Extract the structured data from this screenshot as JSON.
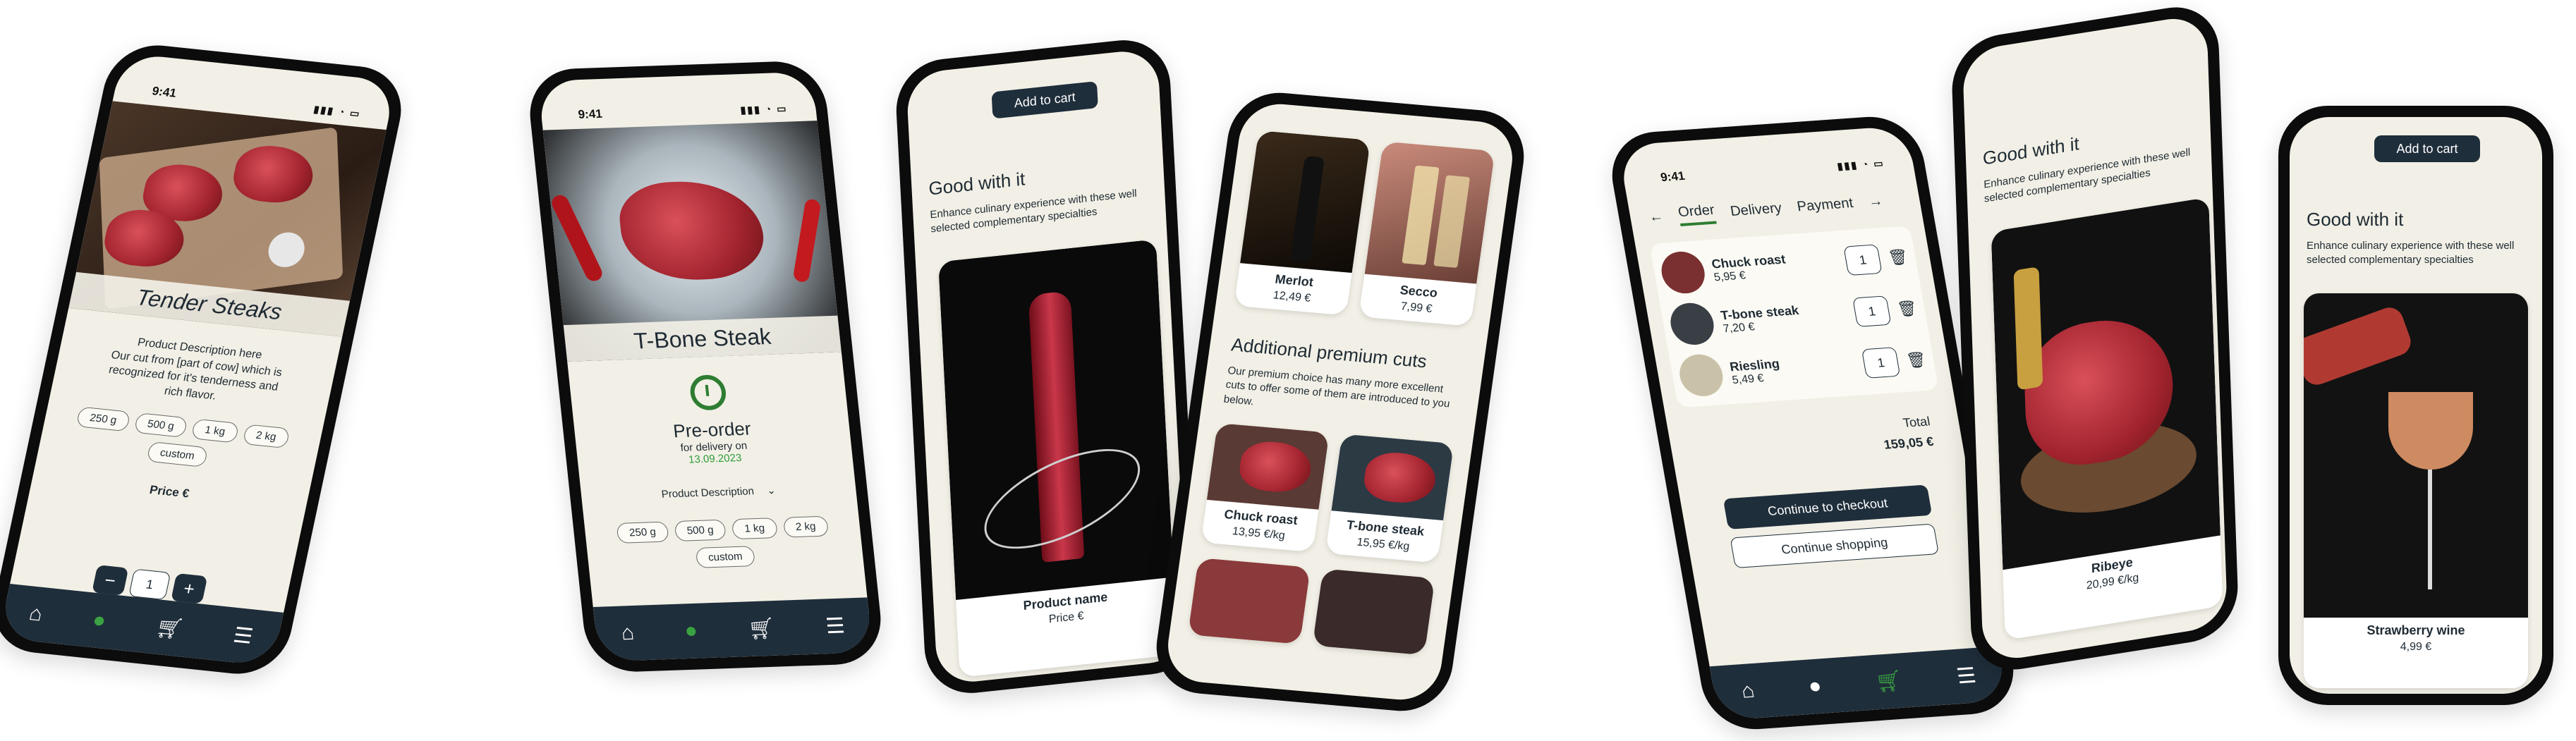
{
  "status": {
    "time": "9:41"
  },
  "nav_icons": [
    "home-icon",
    "apple-icon",
    "cart-icon",
    "menu-icon"
  ],
  "phone1": {
    "title": "Tender Steaks",
    "desc_title": "Product Description here",
    "desc_body": "Our cut from [part of cow] which is recognized for it's tenderness and rich flavor.",
    "sizes": [
      "250 g",
      "500 g",
      "1 kg",
      "2 kg",
      "custom"
    ],
    "price_label": "Price €",
    "qty": "1",
    "minus": "−",
    "plus": "+"
  },
  "phone2": {
    "title": "T-Bone Steak",
    "preorder": "Pre-order",
    "delivery_label": "for delivery on",
    "delivery_date": "13.09.2023",
    "desc_toggle": "Product Description",
    "sizes": [
      "250 g",
      "500 g",
      "1 kg",
      "2 kg",
      "custom"
    ]
  },
  "phone3": {
    "add_to_cart": "Add to cart",
    "heading": "Good with it",
    "subtitle": "Enhance culinary experience with these well selected complementary specialties",
    "product_name": "Product name",
    "price": "Price €"
  },
  "phone4": {
    "wines": [
      {
        "name": "Merlot",
        "price": "12,49 €"
      },
      {
        "name": "Secco",
        "price": "7,99 €"
      }
    ],
    "heading": "Additional premium cuts",
    "text": "Our premium choice has many more excellent cuts to offer some of them are introduced to you below.",
    "cuts": [
      {
        "name": "Chuck roast",
        "price": "13,95 €/kg"
      },
      {
        "name": "T-bone steak",
        "price": "15,95 €/kg"
      }
    ]
  },
  "phone5": {
    "tabs": [
      "Order",
      "Delivery",
      "Payment"
    ],
    "items": [
      {
        "name": "Chuck roast",
        "price": "5,95 €",
        "qty": "1"
      },
      {
        "name": "T-bone steak",
        "price": "7,20 €",
        "qty": "1"
      },
      {
        "name": "Riesling",
        "price": "5,49 €",
        "qty": "1"
      }
    ],
    "total_label": "Total",
    "total_value": "159,05 €",
    "checkout": "Continue to checkout",
    "shopping": "Continue shopping"
  },
  "phone6": {
    "heading": "Good with it",
    "subtitle": "Enhance culinary experience with these well selected complementary specialties",
    "product": "Ribeye",
    "price": "20,99 €/kg"
  },
  "phone7": {
    "add_to_cart": "Add to cart",
    "heading": "Good with it",
    "subtitle": "Enhance culinary experience with these well selected complementary specialties",
    "product": "Strawberry wine",
    "price": "4,99 €"
  }
}
